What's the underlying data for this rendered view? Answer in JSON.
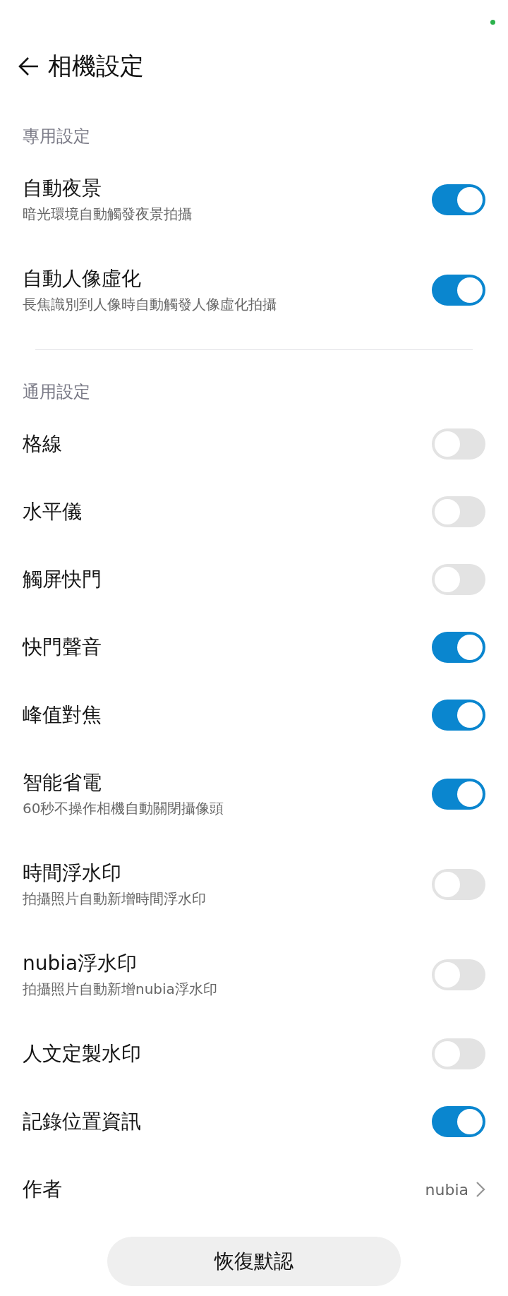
{
  "header": {
    "title": "相機設定"
  },
  "sections": [
    {
      "title": "專用設定",
      "items": [
        {
          "kind": "toggle",
          "title": "自動夜景",
          "subtitle": "暗光環境自動觸發夜景拍攝",
          "on": true
        },
        {
          "kind": "toggle",
          "title": "自動人像虛化",
          "subtitle": "長焦識別到人像時自動觸發人像虛化拍攝",
          "on": true
        }
      ]
    },
    {
      "title": "通用設定",
      "items": [
        {
          "kind": "toggle",
          "title": "格線",
          "on": false
        },
        {
          "kind": "toggle",
          "title": "水平儀",
          "on": false
        },
        {
          "kind": "toggle",
          "title": "觸屏快門",
          "on": false
        },
        {
          "kind": "toggle",
          "title": "快門聲音",
          "on": true
        },
        {
          "kind": "toggle",
          "title": "峰值對焦",
          "on": true
        },
        {
          "kind": "toggle",
          "title": "智能省電",
          "subtitle": "60秒不操作相機自動關閉攝像頭",
          "on": true
        },
        {
          "kind": "toggle",
          "title": "時間浮水印",
          "subtitle": "拍攝照片自動新增時間浮水印",
          "on": false
        },
        {
          "kind": "toggle",
          "title": "nubia浮水印",
          "subtitle": "拍攝照片自動新增nubia浮水印",
          "on": false
        },
        {
          "kind": "toggle",
          "title": "人文定製水印",
          "on": false
        },
        {
          "kind": "toggle",
          "title": "記錄位置資訊",
          "on": true
        },
        {
          "kind": "link",
          "title": "作者",
          "value": "nubia"
        }
      ]
    }
  ],
  "reset_button": "恢復默認"
}
